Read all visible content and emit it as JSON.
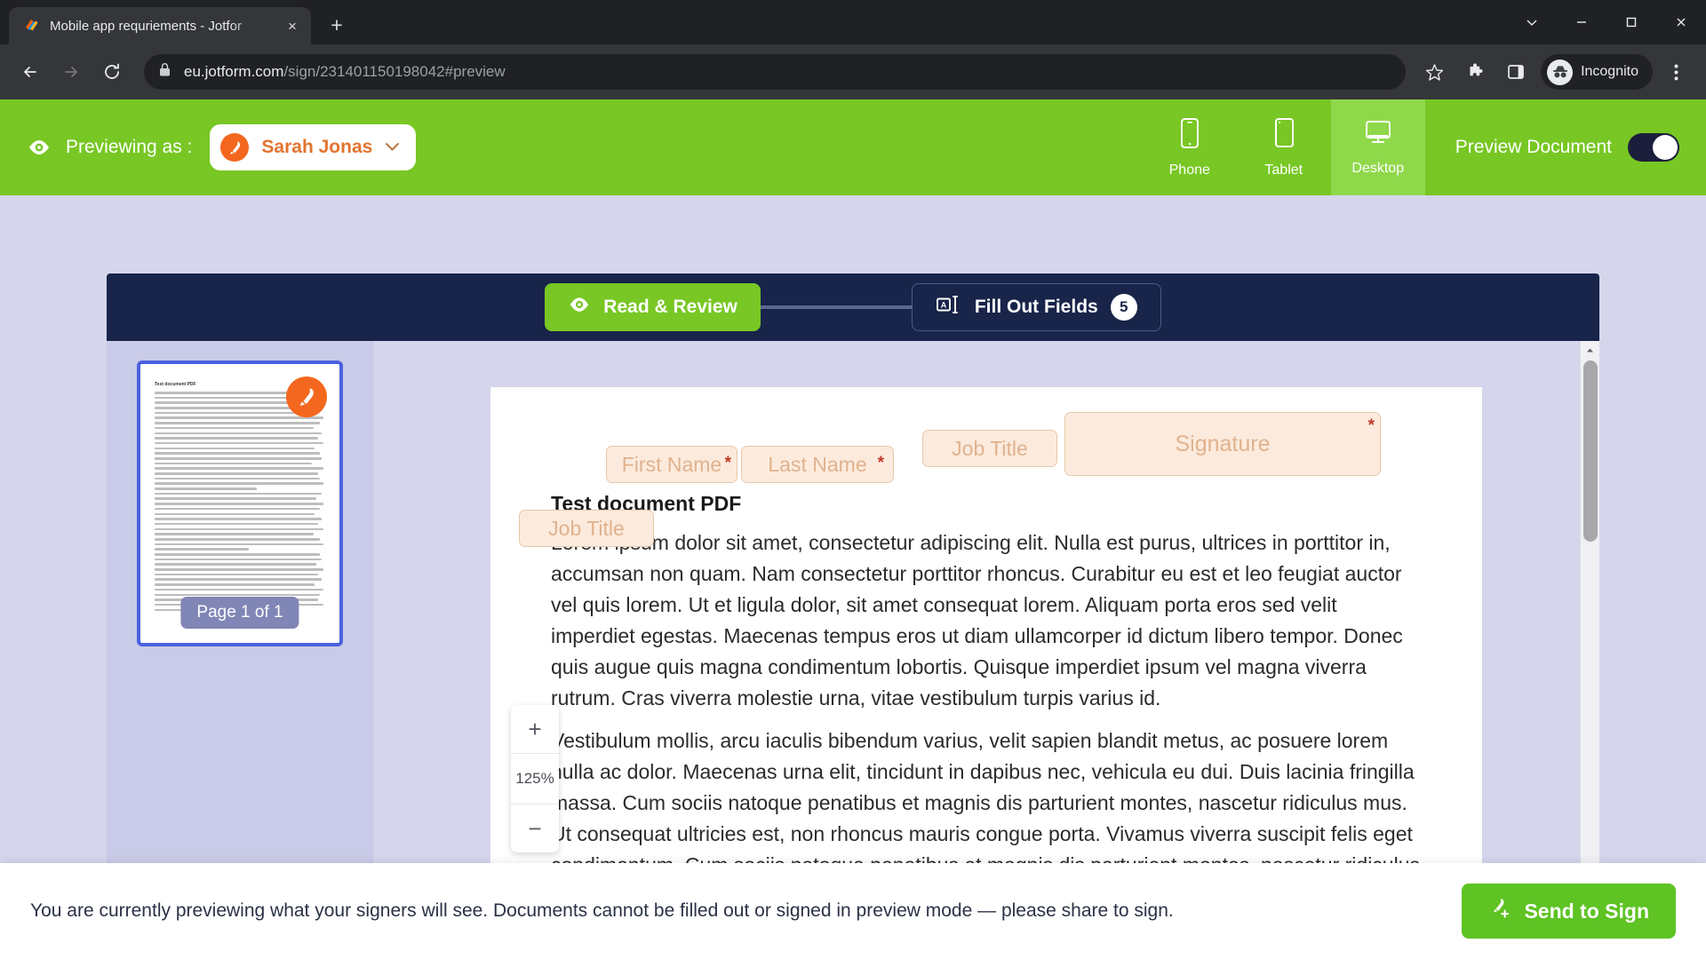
{
  "browser": {
    "tab": {
      "title": "Mobile app requriements - Jotfor",
      "favicon": "jotform-favicon",
      "close": "×"
    },
    "new_tab": "+",
    "window_controls": {
      "minimize_all": "⌄",
      "minimize": "—",
      "maximize": "□",
      "close": "✕"
    },
    "nav": {
      "back": "←",
      "forward": "→",
      "reload": "↻"
    },
    "omnibox": {
      "lock": "lock-icon",
      "url_domain": "eu.jotform.com",
      "url_path": "/sign/231401150198042#preview"
    },
    "actions": {
      "bookmark": "star-icon",
      "extensions": "puzzle-icon",
      "side_panel": "side-panel-icon",
      "incognito_label": "Incognito",
      "menu": "kebab-menu-icon"
    }
  },
  "app_header": {
    "previewing_label": "Previewing as :",
    "signer_name": "Sarah Jonas",
    "chevron": "⌄",
    "devices": [
      {
        "label": "Phone",
        "icon": "phone-icon",
        "active": false
      },
      {
        "label": "Tablet",
        "icon": "tablet-icon",
        "active": false
      },
      {
        "label": "Desktop",
        "icon": "desktop-icon",
        "active": true
      }
    ],
    "preview_document_label": "Preview Document",
    "preview_document_on": true,
    "accent_green": "#78c724",
    "accent_green_active": "#8fd84a",
    "signer_orange": "#f4671f"
  },
  "steps": {
    "read_review_label": "Read & Review",
    "fill_out_label": "Fill Out Fields",
    "fill_out_count": "5",
    "bar_color": "#182449"
  },
  "thumbnails": {
    "page_badge": "Page 1 of 1",
    "doc_mini_title": "Test document PDF"
  },
  "zoom_control": {
    "increase": "+",
    "level": "125%",
    "decrease": "−"
  },
  "document": {
    "title": "Test document PDF",
    "paragraph1": "Lorem ipsum dolor sit amet, consectetur adipiscing elit. Nulla est purus, ultrices in porttitor in, accumsan non quam. Nam consectetur porttitor rhoncus. Curabitur eu est et leo feugiat auctor vel quis lorem. Ut et ligula dolor, sit amet consequat lorem. Aliquam porta eros sed velit imperdiet egestas. Maecenas tempus eros ut diam ullamcorper id dictum libero tempor. Donec quis augue quis magna condimentum lobortis. Quisque imperdiet ipsum vel magna viverra rutrum. Cras viverra molestie urna, vitae vestibulum turpis varius id.",
    "paragraph2": "Vestibulum mollis, arcu iaculis bibendum varius, velit sapien blandit metus, ac posuere lorem nulla ac dolor. Maecenas urna elit, tincidunt in dapibus nec, vehicula eu dui. Duis lacinia fringilla massa. Cum sociis natoque penatibus et magnis dis parturient montes, nascetur ridiculus mus. Ut consequat ultricies est, non rhoncus mauris congue porta. Vivamus viverra suscipit felis eget condimentum. Cum sociis natoque penatibus et magnis dis parturient montes, nascetur ridiculus mus. Integer bibendum sagittis ligula, non faucibus nulla volutpat",
    "fields": {
      "first_name": "First Name",
      "first_name_required": "*",
      "last_name": "Last Name",
      "last_name_required": "*",
      "job_title_1": "Job Title",
      "job_title_2": "Job Title",
      "signature": "Signature",
      "signature_required": "*",
      "fill_bg": "#fcebdd",
      "fill_border": "#e8c7a8",
      "required_color": "#c0392b"
    }
  },
  "bottom": {
    "message": "You are currently previewing what your signers will see. Documents cannot be filled out or signed in preview mode — please share to sign.",
    "send_label": "Send to Sign",
    "send_color": "#5ec323"
  }
}
